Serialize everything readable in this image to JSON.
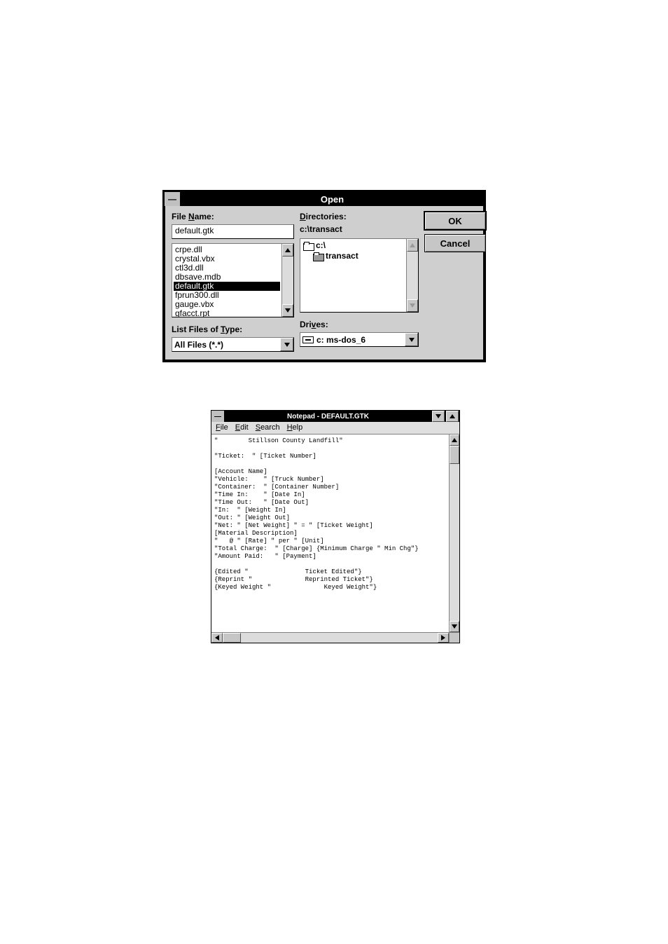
{
  "openDialog": {
    "title": "Open",
    "fileNameLabelPre": "File ",
    "fileNameMn": "N",
    "fileNameLabelPost": "ame:",
    "fileNameValue": "default.gtk",
    "files": [
      "crpe.dll",
      "crystal.vbx",
      "ctl3d.dll",
      "dbsave.mdb",
      "default.gtk",
      "fprun300.dll",
      "gauge.vbx",
      "gfacct.rpt"
    ],
    "selectedFile": "default.gtk",
    "listTypeLabelPre": "List Files of ",
    "listTypeMn": "T",
    "listTypeLabelPost": "ype:",
    "listTypeValue": "All Files (*.*)",
    "dirLabelMn": "D",
    "dirLabelPost": "irectories:",
    "dirPath": "c:\\transact",
    "dirs": [
      "c:\\",
      "transact"
    ],
    "drivesLabelPre": "Dri",
    "drivesMn": "v",
    "drivesLabelPost": "es:",
    "drivesValue": "c: ms-dos_6",
    "okLabel": "OK",
    "cancelLabel": "Cancel"
  },
  "notepad": {
    "title": "Notepad - DEFAULT.GTK",
    "menu": {
      "fileMn": "F",
      "filePost": "ile",
      "editMn": "E",
      "editPost": "dit",
      "searchMn": "S",
      "searchPost": "earch",
      "helpMn": "H",
      "helpPost": "elp"
    },
    "content": "\"        Stillson County Landfill\"\n\n\"Ticket:  \" [Ticket Number]\n\n[Account Name]\n\"Vehicle:    \" [Truck Number]\n\"Container:  \" [Container Number]\n\"Time In:    \" [Date In]\n\"Time Out:   \" [Date Out]\n\"In:  \" [Weight In]\n\"Out: \" [Weight Out]\n\"Net: \" [Net Weight] \" = \" [Ticket Weight]\n[Material Description]\n\"   @ \" [Rate] \" per \" [Unit]\n\"Total Charge:  \" [Charge] {Minimum Charge \" Min Chg\"}\n\"Amount Paid:   \" [Payment]\n\n{Edited \"               Ticket Edited\"}\n{Reprint \"              Reprinted Ticket\"}\n{Keyed Weight \"              Keyed Weight\"}"
  }
}
